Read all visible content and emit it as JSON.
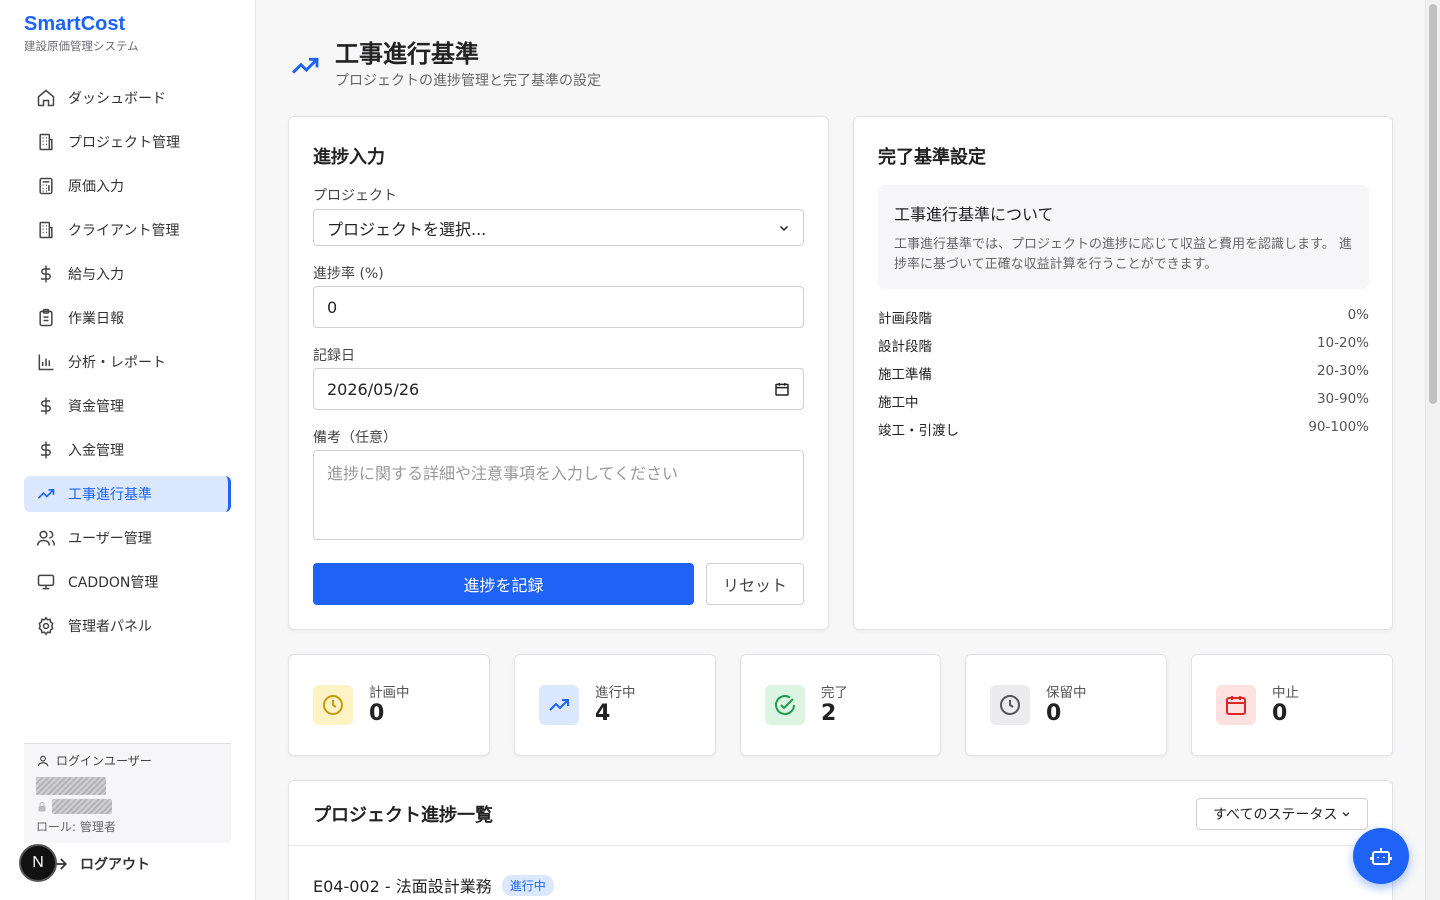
{
  "brand": {
    "name": "SmartCost",
    "subtitle": "建設原価管理システム"
  },
  "nav": [
    {
      "label": "ダッシュボード",
      "icon": "home-icon"
    },
    {
      "label": "プロジェクト管理",
      "icon": "building-icon"
    },
    {
      "label": "原価入力",
      "icon": "calculator-icon"
    },
    {
      "label": "クライアント管理",
      "icon": "building-icon"
    },
    {
      "label": "給与入力",
      "icon": "dollar-icon"
    },
    {
      "label": "作業日報",
      "icon": "clipboard-icon"
    },
    {
      "label": "分析・レポート",
      "icon": "bar-chart-icon"
    },
    {
      "label": "資金管理",
      "icon": "dollar-icon"
    },
    {
      "label": "入金管理",
      "icon": "dollar-icon"
    },
    {
      "label": "工事進行基準",
      "icon": "trending-up-icon",
      "active": true
    },
    {
      "label": "ユーザー管理",
      "icon": "users-icon"
    },
    {
      "label": "CADDON管理",
      "icon": "monitor-icon"
    },
    {
      "label": "管理者パネル",
      "icon": "gear-icon"
    }
  ],
  "user": {
    "label": "ログインユーザー",
    "role": "ロール: 管理者",
    "logout": "ログアウト",
    "badge": "N"
  },
  "header": {
    "title": "工事進行基準",
    "subtitle": "プロジェクトの進捗管理と完了基準の設定"
  },
  "progress_form": {
    "title": "進捗入力",
    "project_label": "プロジェクト",
    "project_value": "プロジェクトを選択...",
    "rate_label": "進捗率 (%)",
    "rate_value": "0",
    "date_label": "記録日",
    "date_value": "2026/05/26",
    "note_label": "備考（任意）",
    "note_placeholder": "進捗に関する詳細や注意事項を入力してください",
    "submit": "進捗を記録",
    "reset": "リセット"
  },
  "criteria": {
    "title": "完了基準設定",
    "about_title": "工事進行基準について",
    "about_text": "工事進行基準では、プロジェクトの進捗に応じて収益と費用を認識します。 進捗率に基づいて正確な収益計算を行うことができます。",
    "phases": [
      {
        "name": "計画段階",
        "pct": "0%"
      },
      {
        "name": "設計段階",
        "pct": "10-20%"
      },
      {
        "name": "施工準備",
        "pct": "20-30%"
      },
      {
        "name": "施工中",
        "pct": "30-90%"
      },
      {
        "name": "竣工・引渡し",
        "pct": "90-100%"
      }
    ]
  },
  "stats": [
    {
      "label": "計画中",
      "value": "0",
      "icon": "clock-icon",
      "bg": "#fdf3c4",
      "fg": "#c89b0a"
    },
    {
      "label": "進行中",
      "value": "4",
      "icon": "trending-up-icon",
      "bg": "#dbe8ff",
      "fg": "#1e63f5"
    },
    {
      "label": "完了",
      "value": "2",
      "icon": "check-circle-icon",
      "bg": "#dcf5e3",
      "fg": "#1f9a4b"
    },
    {
      "label": "保留中",
      "value": "0",
      "icon": "clock-icon",
      "bg": "#ececee",
      "fg": "#555555"
    },
    {
      "label": "中止",
      "value": "0",
      "icon": "calendar-icon",
      "bg": "#fde0e0",
      "fg": "#dc2626"
    }
  ],
  "project_list": {
    "title": "プロジェクト進捗一覧",
    "filter": "すべてのステータス",
    "rows": [
      {
        "name": "E04-002 - 法面設計業務",
        "status": "進行中"
      }
    ]
  },
  "colors": {
    "accent": "#1e63f5"
  }
}
